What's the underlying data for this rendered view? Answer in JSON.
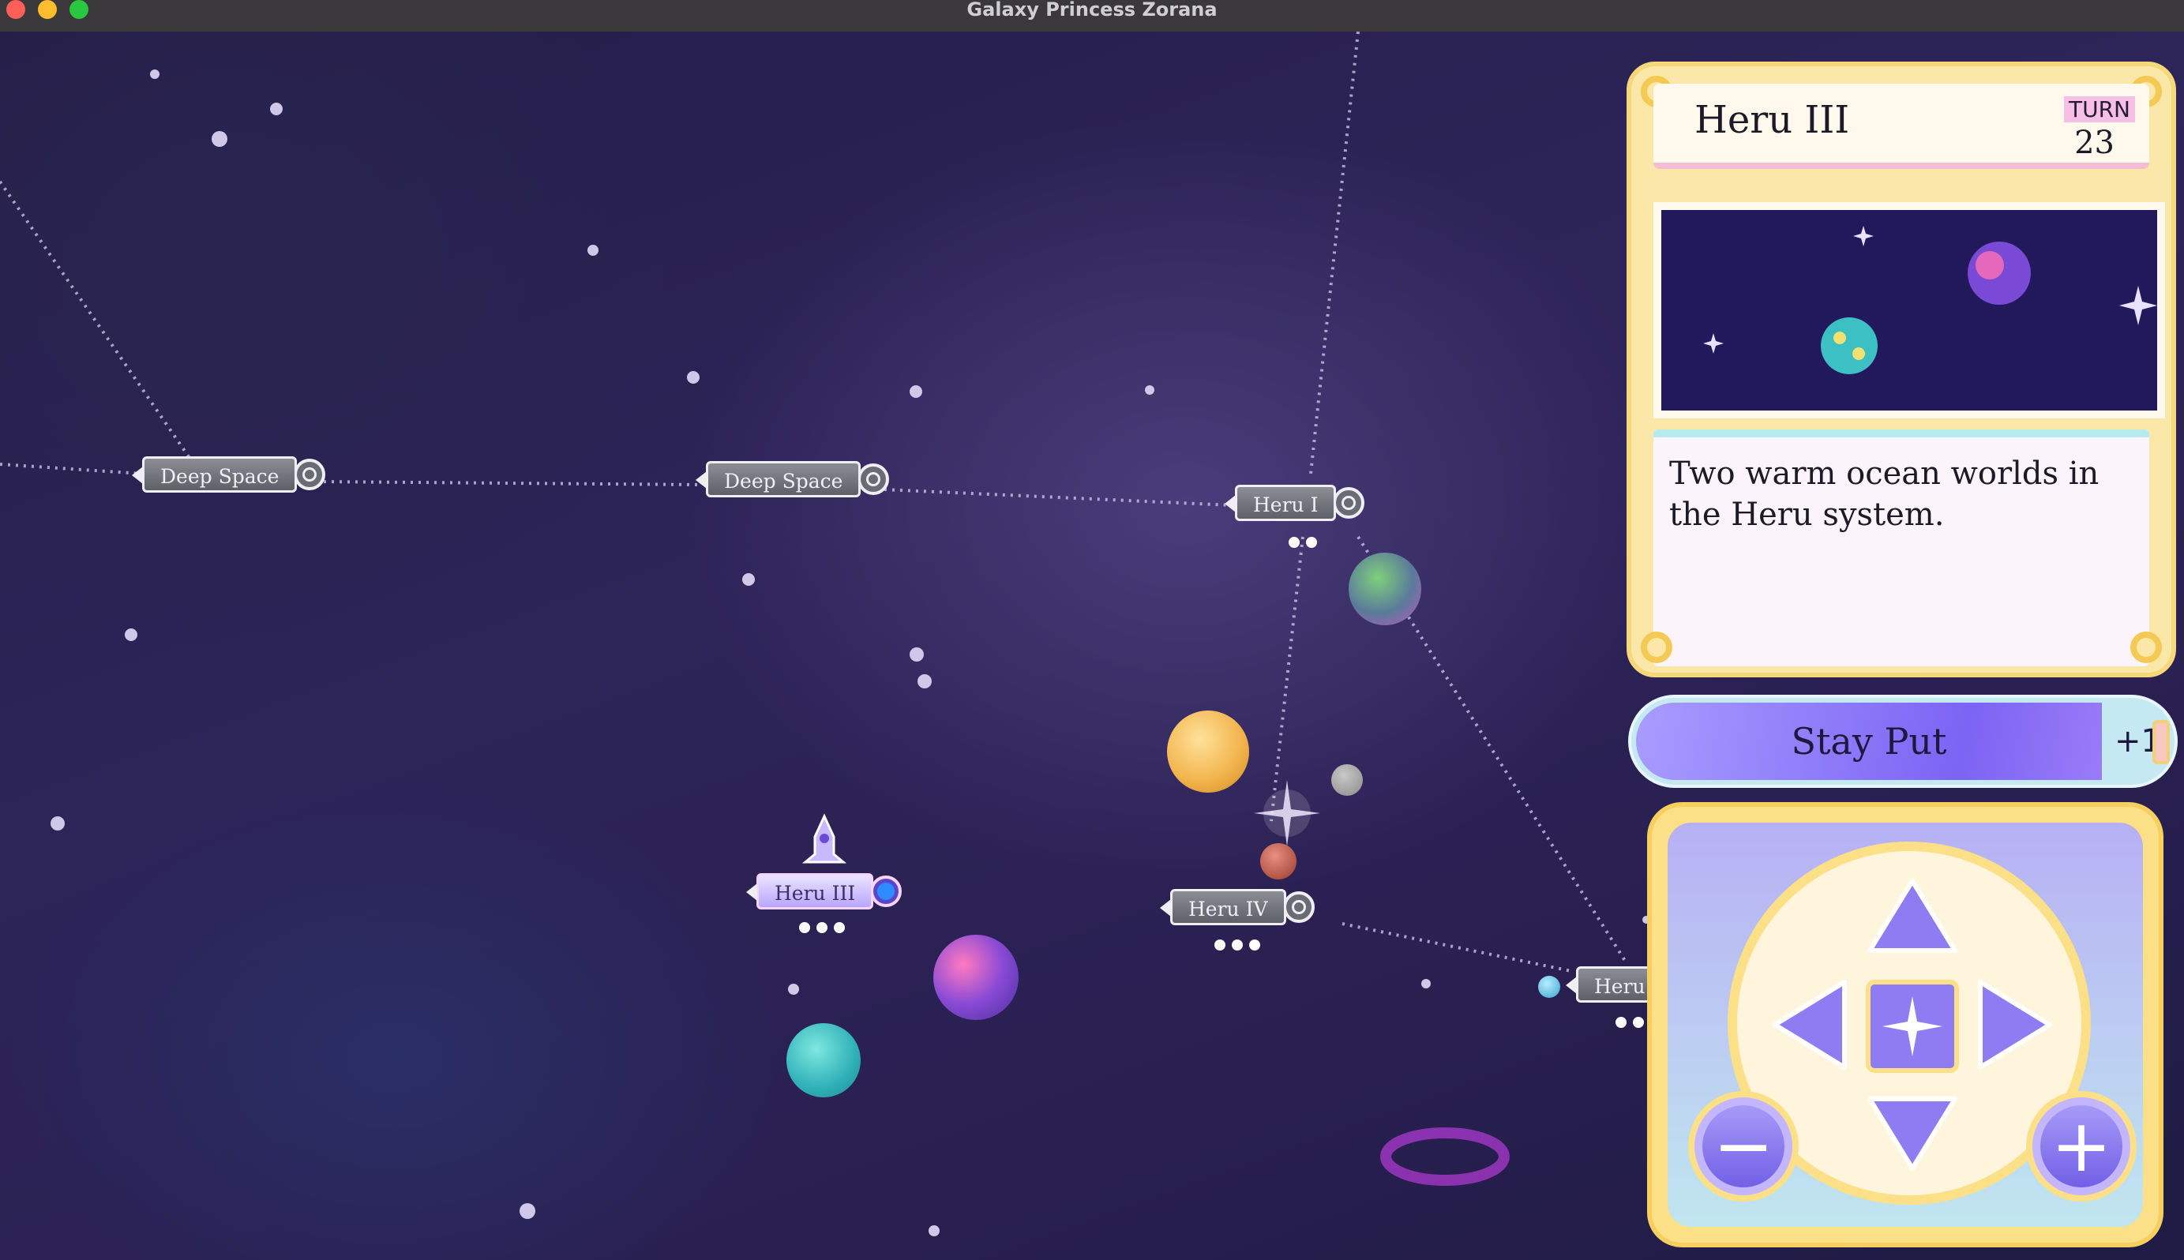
{
  "window": {
    "title": "Galaxy Princess Zorana",
    "traffic_lights": {
      "close": "#ff5f57",
      "minimize": "#febc2e",
      "zoom": "#28c840"
    }
  },
  "map": {
    "nodes": [
      {
        "id": "deep-space-1",
        "label": "Deep Space",
        "dots": 0
      },
      {
        "id": "deep-space-2",
        "label": "Deep Space",
        "dots": 0
      },
      {
        "id": "heru-i",
        "label": "Heru I",
        "dots": 2
      },
      {
        "id": "heru-iii",
        "label": "Heru III",
        "dots": 3,
        "current": true
      },
      {
        "id": "heru-iv",
        "label": "Heru IV",
        "dots": 3
      },
      {
        "id": "heru-partial",
        "label": "Heru",
        "dots": 2
      }
    ]
  },
  "info_panel": {
    "title": "Heru III",
    "turn_label": "TURN",
    "turn_value": "23",
    "description": "Two warm ocean worlds in the Heru system."
  },
  "actions": {
    "stay_put_label": "Stay Put",
    "stay_put_cost": "+1",
    "cost_icon": "hourglass-icon"
  },
  "controls": {
    "up": "arrow-up-icon",
    "down": "arrow-down-icon",
    "left": "arrow-left-icon",
    "right": "arrow-right-icon",
    "center": "star-icon",
    "zoom_out": "minus-icon",
    "zoom_in": "plus-icon"
  },
  "colors": {
    "space_bg": "#2a2052",
    "panel_gold": "#fbe088",
    "accent_purple": "#7c64f4"
  }
}
